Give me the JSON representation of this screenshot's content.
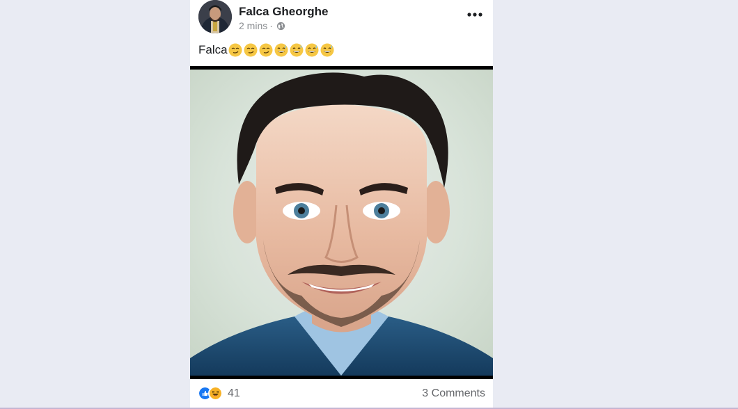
{
  "post": {
    "author": "Falca Gheorghe",
    "time": "2 mins",
    "separator": "·",
    "privacy_icon": "globe-icon",
    "text": "Falca",
    "emojis": [
      "smirk",
      "smirk",
      "smirk",
      "grin-sweat",
      "grin-sweat",
      "grin-sweat",
      "grin-sweat"
    ],
    "image": "portrait-photo"
  },
  "footer": {
    "reaction_count": "41",
    "comments": "3 Comments"
  },
  "colors": {
    "like_blue": "#1877f2",
    "haha_yellow": "#f7b125",
    "meta_gray": "#65676b"
  }
}
